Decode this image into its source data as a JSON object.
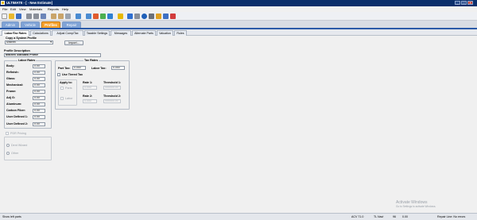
{
  "window": {
    "title": "ULTIMATE - [ - New Estimate]",
    "min": "_",
    "max": "□",
    "close": "✕"
  },
  "menu": [
    "File",
    "Edit",
    "View",
    "Materials",
    "Reports",
    "Help"
  ],
  "main_tabs": [
    "Admin",
    "Vehicle",
    "Profiles",
    "Repair"
  ],
  "sub_tabs": [
    "Labor/Tax Rates",
    "Calculations",
    "Adjust Comp/Tax",
    "Taxable Settings",
    "Messages",
    "Alternate Parts",
    "Valuation",
    "Rules"
  ],
  "copy_profile": {
    "label": "Copy a System Profile",
    "value": "Mitchell",
    "import": "Import..."
  },
  "profile_description": {
    "label": "Profile Description",
    "value": "Mitchell Standard Profile"
  },
  "labor_rates": {
    "title": "Labor Rates",
    "rows": [
      {
        "label": "Body:",
        "value": "0.00"
      },
      {
        "label": "Refinish:",
        "value": "0.00"
      },
      {
        "label": "Glass:",
        "value": "0.00"
      },
      {
        "label": "Mechanical:",
        "value": "0.00"
      },
      {
        "label": "Frame:",
        "value": "0.00"
      },
      {
        "label": "Adj G:",
        "value": "0.00"
      },
      {
        "label": "Aluminum:",
        "value": "0.00"
      },
      {
        "label": "Carbon Fiber:",
        "value": "0.00"
      },
      {
        "label": "User Defined 1:",
        "value": "0.00"
      },
      {
        "label": "User Defined 2:",
        "value": "0.00"
      }
    ]
  },
  "tax_rates": {
    "title": "Tax Rates",
    "part_tax_label": "Part Tax:",
    "part_tax_value": "0.000",
    "labor_tax_label": "Labor Tax:",
    "labor_tax_value": "0.000",
    "use_tiered_label": "Use Tiered Tax",
    "apply_to_label": "Apply to:",
    "parts_label": "Parts",
    "labor_label": "Labor",
    "rate1_label": "Rate 1:",
    "rate1_value": "0.000",
    "threshold1_label": "Threshold 1:",
    "threshold1_value": "999999.99",
    "rate2_label": "Rate 2:",
    "rate2_value": "0.000",
    "threshold2_label": "Threshold 2:",
    "threshold2_value": "999999.99"
  },
  "pdr_pricing": {
    "label": "PDR Pricing",
    "option1": "Dent Wizard",
    "option2": "Other"
  },
  "watermark": {
    "line1": "Activate Windows",
    "line2": "Go to Settings to activate Windows."
  },
  "status": {
    "left": "Show left parts",
    "v1": "ACV 71.0",
    "v2": "TL Navi",
    "v3": "96",
    "v4": "0.00",
    "right": "Repair Line: No errors"
  }
}
